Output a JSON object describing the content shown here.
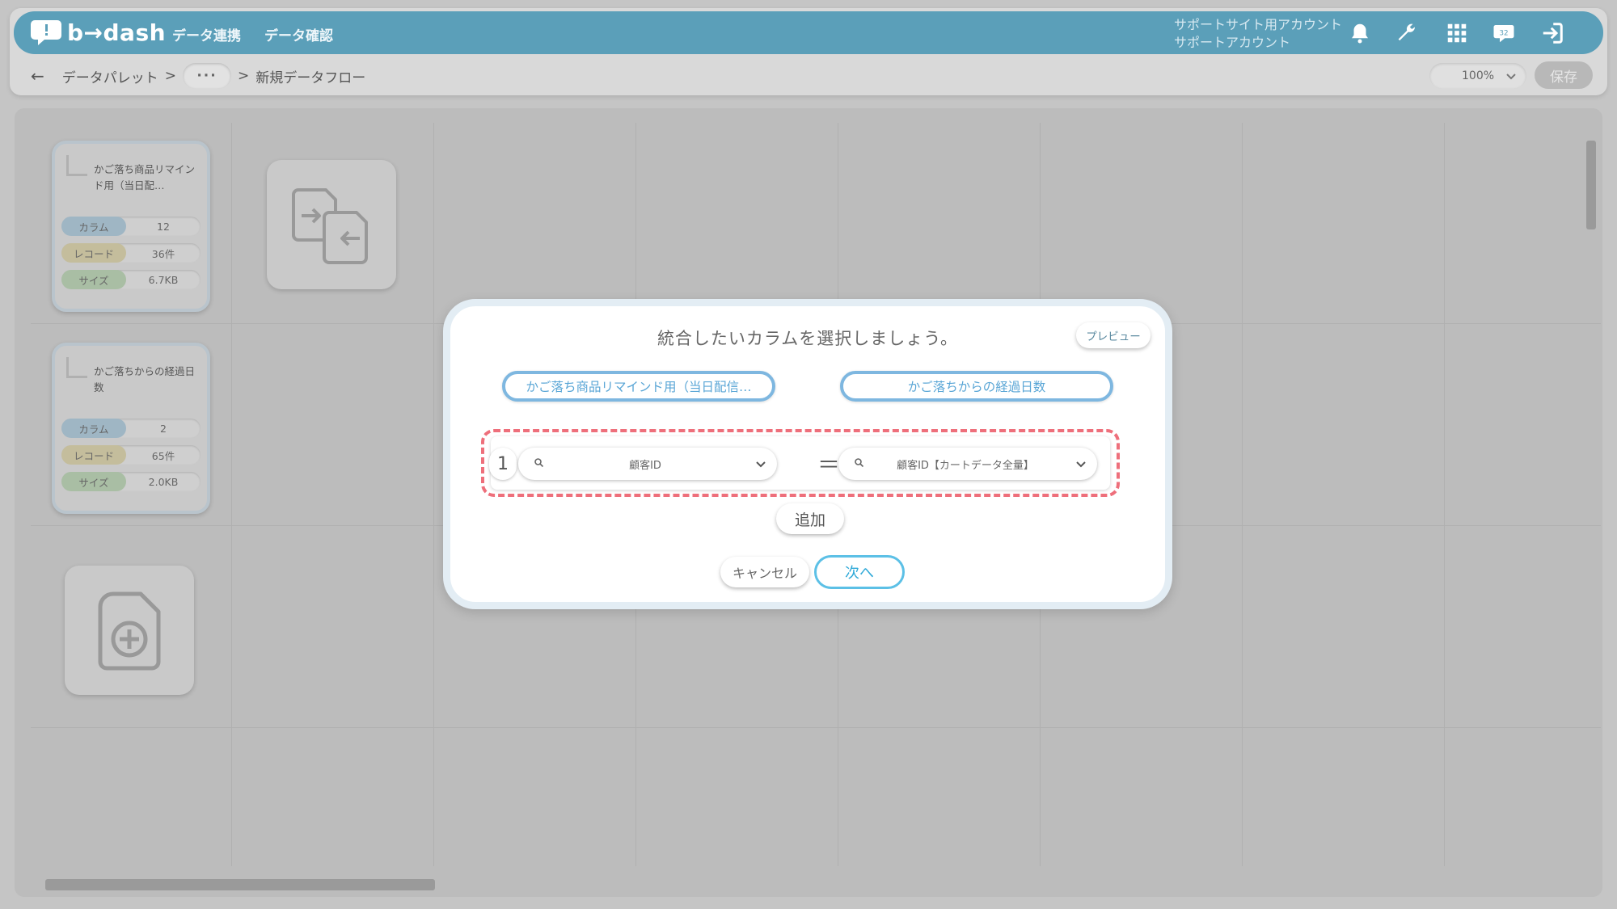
{
  "header": {
    "brand": "b→dash",
    "nav": [
      "データ連携",
      "データ確認"
    ],
    "account_line1": "サポートサイト用アカウント",
    "account_line2": "サポートアカウント",
    "icons": [
      "bell-icon",
      "wrench-icon",
      "apps-grid-icon",
      "chat-badge-icon",
      "logout-icon"
    ],
    "chat_badge": "32"
  },
  "breadcrumb": {
    "back": "←",
    "root": "データパレット",
    "sep": ">",
    "ellipsis": "···",
    "current": "新規データフロー"
  },
  "toolbar": {
    "zoom": "100%",
    "save": "保存"
  },
  "canvas": {
    "nodes": [
      {
        "title": "かご落ち商品リマインド用（当日配…",
        "stats": [
          {
            "key": "カラム",
            "value": "12"
          },
          {
            "key": "レコード",
            "value": "36件"
          },
          {
            "key": "サイズ",
            "value": "6.7KB"
          }
        ]
      },
      {
        "title": "かご落ちからの経過日数",
        "stats": [
          {
            "key": "カラム",
            "value": "2"
          },
          {
            "key": "レコード",
            "value": "65件"
          },
          {
            "key": "サイズ",
            "value": "2.0KB"
          }
        ]
      }
    ]
  },
  "modal": {
    "title": "統合したいカラムを選択しましょう。",
    "preview": "プレビュー",
    "left_source": "かご落ち商品リマインド用（当日配信…",
    "right_source": "かご落ちからの経過日数",
    "rows": [
      {
        "index": "1",
        "left": "顧客ID",
        "operator": "＝",
        "right": "顧客ID【カートデータ全量】"
      }
    ],
    "add": "追加",
    "cancel": "キャンセル",
    "next": "次へ"
  },
  "colors": {
    "topbar": "#5b9fb9",
    "accent": "#5cc0e6",
    "highlight_dash": "#ee6f7b"
  }
}
